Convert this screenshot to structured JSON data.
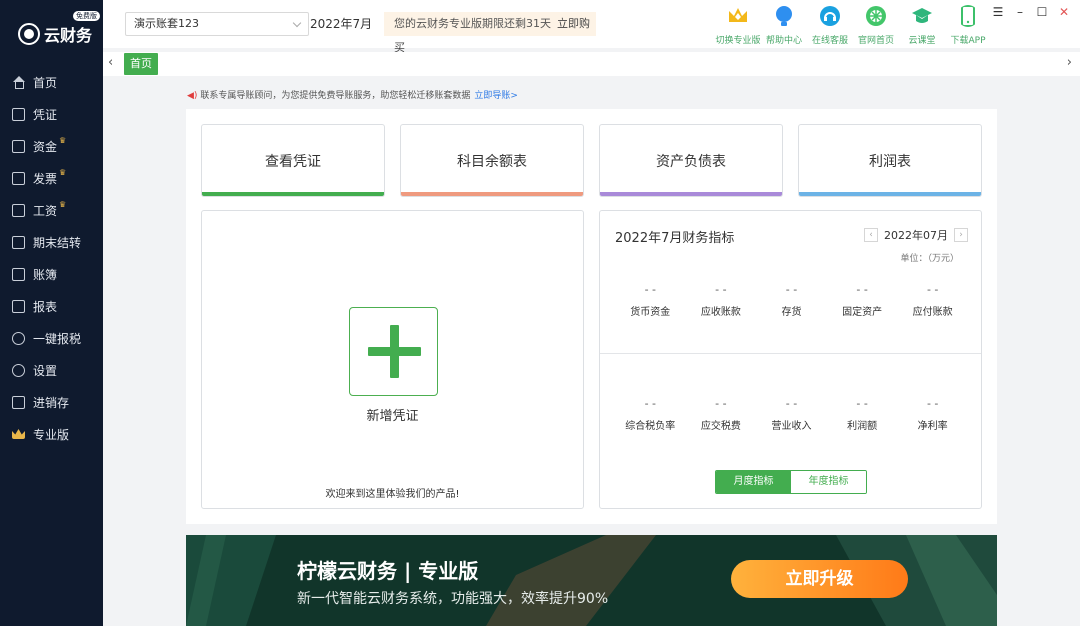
{
  "app": {
    "logo_text": "云财务",
    "logo_badge": "免费版"
  },
  "sidebar": {
    "items": [
      {
        "label": "首页",
        "icon": "home-icon",
        "crown": ""
      },
      {
        "label": "凭证",
        "icon": "voucher-icon",
        "crown": ""
      },
      {
        "label": "资金",
        "icon": "fund-icon",
        "crown": "♛"
      },
      {
        "label": "发票",
        "icon": "invoice-icon",
        "crown": "♛"
      },
      {
        "label": "工资",
        "icon": "salary-icon",
        "crown": "♛"
      },
      {
        "label": "期末结转",
        "icon": "period-close-icon",
        "crown": ""
      },
      {
        "label": "账簿",
        "icon": "ledger-icon",
        "crown": ""
      },
      {
        "label": "报表",
        "icon": "report-icon",
        "crown": ""
      },
      {
        "label": "一键报税",
        "icon": "tax-icon",
        "crown": ""
      },
      {
        "label": "设置",
        "icon": "settings-icon",
        "crown": ""
      },
      {
        "label": "进销存",
        "icon": "inventory-icon",
        "crown": ""
      },
      {
        "label": "专业版",
        "icon": "crown-icon",
        "crown": ""
      }
    ]
  },
  "header": {
    "account": "演示账套123",
    "period": "2022年7月",
    "notice": "您的云财务专业版期限还剩31天",
    "buy_label": "立即购买",
    "tools": [
      {
        "label": "切换专业版",
        "icon": "crown-icon",
        "color": "#f3b81a"
      },
      {
        "label": "帮助中心",
        "icon": "bulb-icon",
        "color": "#2e8ff0"
      },
      {
        "label": "在线客服",
        "icon": "headset-icon",
        "color": "#1aa1e0"
      },
      {
        "label": "官网首页",
        "icon": "lemon-icon",
        "color": "#43c66a"
      },
      {
        "label": "云课堂",
        "icon": "graduation-cap-icon",
        "color": "#2fb67c"
      },
      {
        "label": "下载APP",
        "icon": "phone-icon",
        "color": "#3cc06a"
      }
    ]
  },
  "tabs": {
    "home_label": "首页"
  },
  "migration": {
    "text": "联系专属导账顾问，为您提供免费导账服务，助您轻松迁移账套数据",
    "link": "立即导账>"
  },
  "quick_cards": [
    {
      "label": "查看凭证",
      "color": "#43ad4f"
    },
    {
      "label": "科目余额表",
      "color": "#ef9a7f"
    },
    {
      "label": "资产负债表",
      "color": "#a98ad9"
    },
    {
      "label": "利润表",
      "color": "#6cb3e6"
    }
  ],
  "new_voucher": {
    "label": "新增凭证",
    "welcome": "欢迎来到这里体验我们的产品!"
  },
  "indicators": {
    "title": "2022年7月财务指标",
    "period": "2022年07月",
    "unit": "单位：（万元）",
    "row1": [
      {
        "value": "- -",
        "name": "货币资金"
      },
      {
        "value": "- -",
        "name": "应收账款"
      },
      {
        "value": "- -",
        "name": "存货"
      },
      {
        "value": "- -",
        "name": "固定资产"
      },
      {
        "value": "- -",
        "name": "应付账款"
      }
    ],
    "row2": [
      {
        "value": "- -",
        "name": "综合税负率"
      },
      {
        "value": "- -",
        "name": "应交税费"
      },
      {
        "value": "- -",
        "name": "营业收入"
      },
      {
        "value": "- -",
        "name": "利润额"
      },
      {
        "value": "- -",
        "name": "净利率"
      }
    ],
    "toggle": {
      "monthly": "月度指标",
      "yearly": "年度指标"
    }
  },
  "banner": {
    "title": "柠檬云财务 | 专业版",
    "subtitle": "新一代智能云财务系统，功能强大，效率提升90%",
    "button": "立即升级"
  }
}
